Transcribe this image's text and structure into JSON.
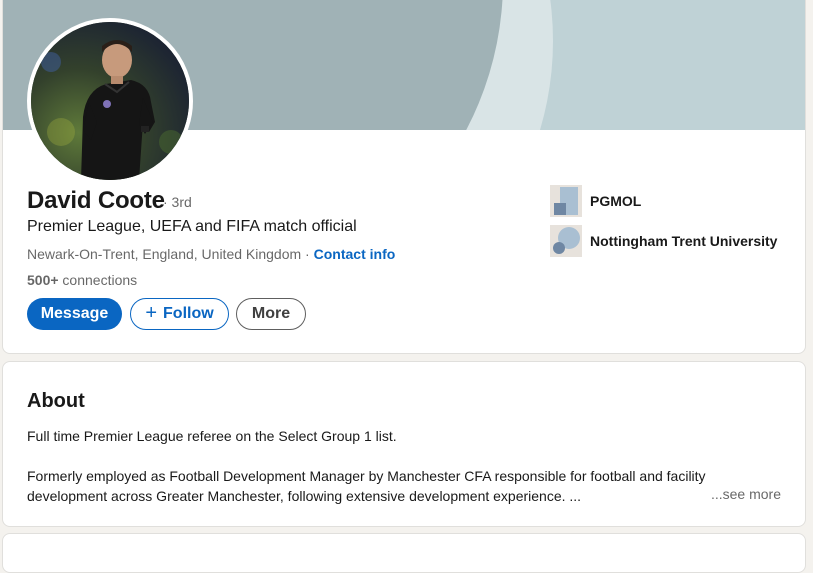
{
  "profile": {
    "name": "David Coote",
    "degree": "· 3rd",
    "headline": "Premier League, UEFA and FIFA match official",
    "location": "Newark-On-Trent, England, United Kingdom",
    "location_sep": " · ",
    "contact_info": "Contact info",
    "connections_count": "500+",
    "connections_label": " connections",
    "buttons": {
      "message": "Message",
      "follow_icon": "+",
      "follow": "Follow",
      "more": "More"
    },
    "orgs": [
      {
        "name": "PGMOL",
        "icon": "company-logo"
      },
      {
        "name": "Nottingham Trent University",
        "icon": "school-logo"
      }
    ]
  },
  "about": {
    "title": "About",
    "paragraph1": "Full time Premier League referee on the Select Group 1 list.",
    "paragraph2": "Formerly employed as Football Development Manager by Manchester CFA responsible for football and facility development across Greater Manchester, following extensive development experience. ...",
    "see_more": "...see more"
  },
  "colors": {
    "accent": "#0a66c2",
    "banner": "#a0b2b6",
    "page_bg": "#f4f2ee"
  }
}
